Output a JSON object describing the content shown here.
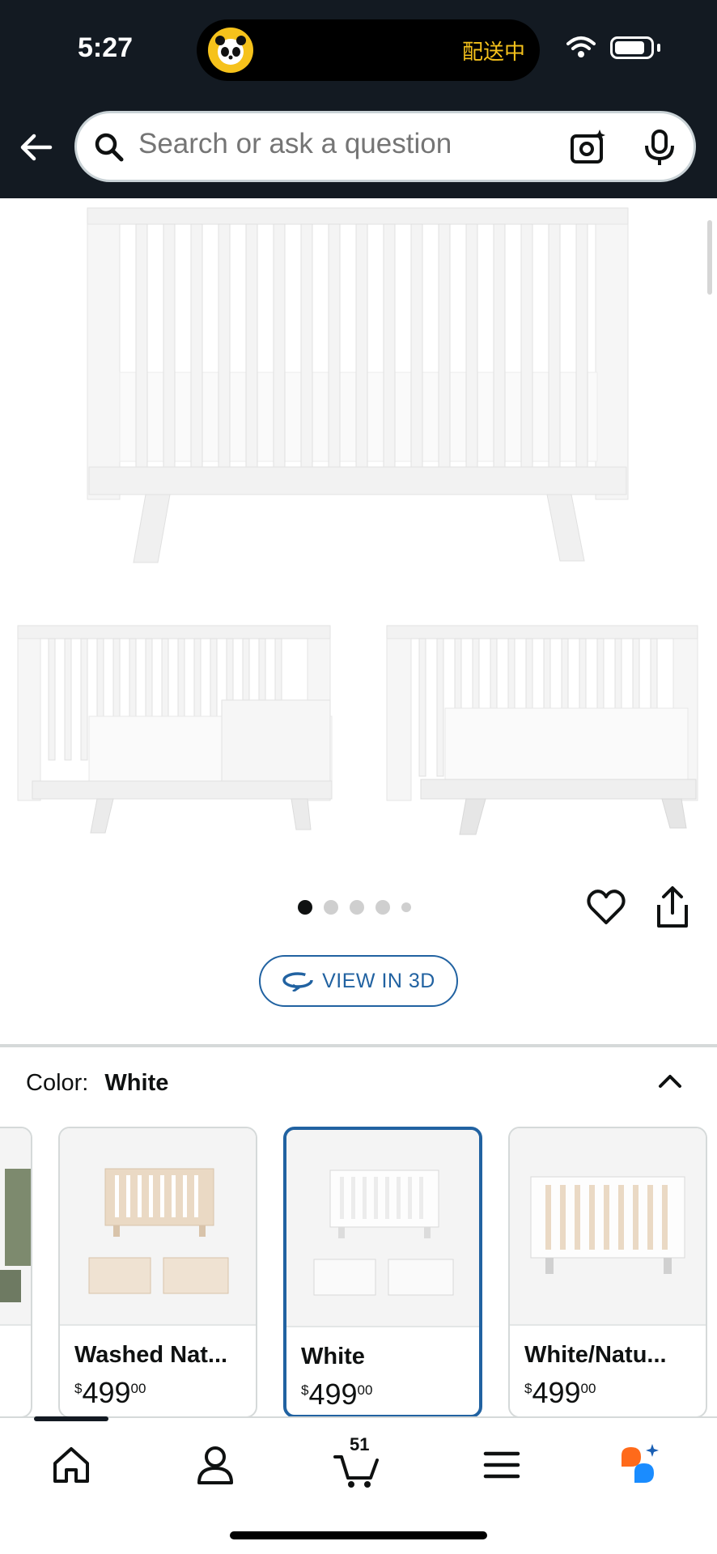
{
  "status_bar": {
    "time": "5:27",
    "island_text": "配送中"
  },
  "search": {
    "placeholder": "Search or ask a question"
  },
  "gallery": {
    "dots_total": 5,
    "active_dot": 0
  },
  "view_3d_label": "VIEW IN 3D",
  "color_selector": {
    "label": "Color:",
    "value": "White",
    "swatches": [
      {
        "name": "Washed Nat...",
        "price_dollars": "$",
        "price_main": "499",
        "price_cents": "00"
      },
      {
        "name": "White",
        "price_dollars": "$",
        "price_main": "499",
        "price_cents": "00"
      },
      {
        "name": "White/Natu...",
        "price_dollars": "$",
        "price_main": "499",
        "price_cents": "00"
      }
    ]
  },
  "bottom_nav": {
    "cart_count": "51"
  },
  "colors": {
    "header_bg": "#131a22",
    "accent": "#2162a1",
    "island_text": "#f6c21b"
  }
}
